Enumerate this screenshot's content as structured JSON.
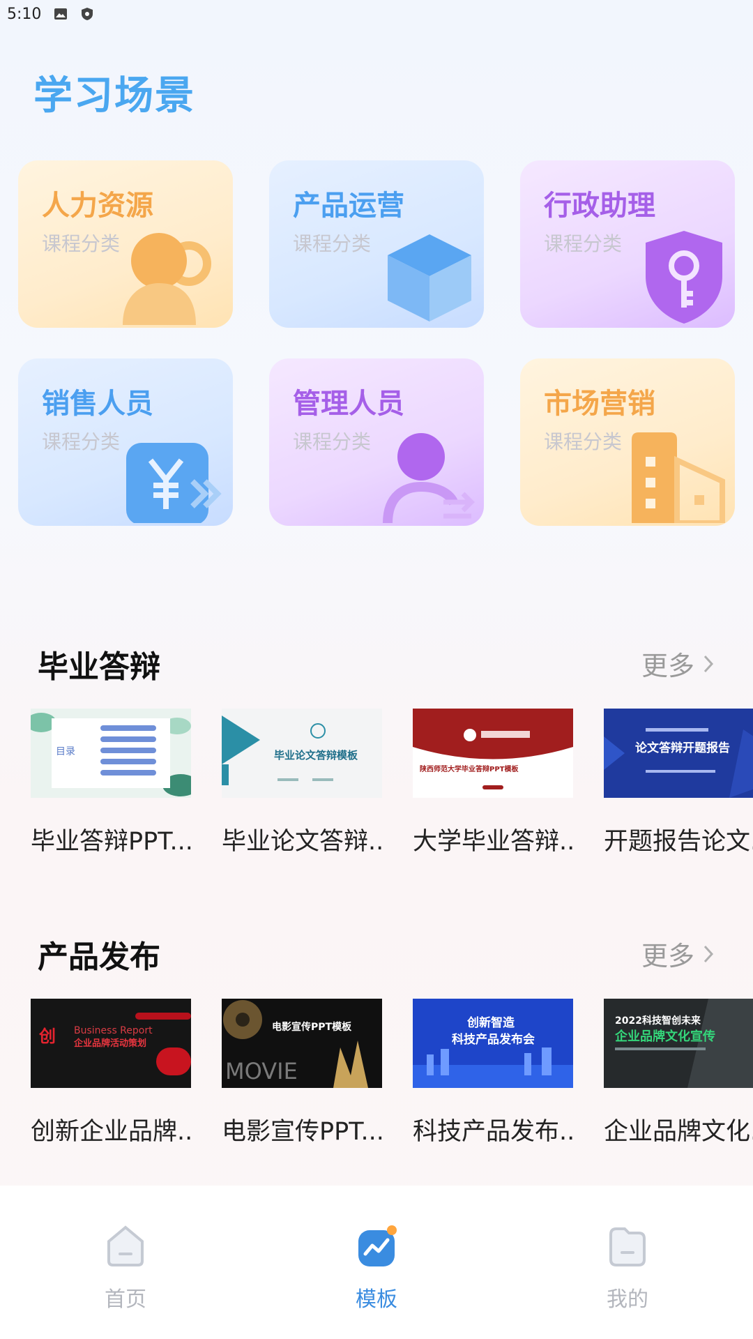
{
  "status": {
    "time": "5:10"
  },
  "learning": {
    "title": "学习场景",
    "cards": [
      {
        "title": "人力资源",
        "sub": "课程分类"
      },
      {
        "title": "产品运营",
        "sub": "课程分类"
      },
      {
        "title": "行政助理",
        "sub": "课程分类"
      },
      {
        "title": "销售人员",
        "sub": "课程分类"
      },
      {
        "title": "管理人员",
        "sub": "课程分类"
      },
      {
        "title": "市场营销",
        "sub": "课程分类"
      }
    ]
  },
  "graduation": {
    "title": "毕业答辩",
    "more": "更多",
    "items": [
      {
        "caption": "毕业答辩PPT...",
        "thumb_text": "目录"
      },
      {
        "caption": "毕业论文答辩...",
        "thumb_text": "毕业论文答辩模板"
      },
      {
        "caption": "大学毕业答辩...",
        "thumb_text": "陕西师范大学毕业答辩PPT模板"
      },
      {
        "caption": "开题报告论文...",
        "thumb_text": "论文答辩开题报告"
      }
    ]
  },
  "product_launch": {
    "title": "产品发布",
    "more": "更多",
    "items": [
      {
        "caption": "创新企业品牌...",
        "thumb_text": "企业品牌活动策划",
        "thumb_text2": "Business Report"
      },
      {
        "caption": "电影宣传PPT...",
        "thumb_text": "电影宣传PPT模板",
        "thumb_text2": "MOVIE"
      },
      {
        "caption": "科技产品发布...",
        "thumb_text": "创新智造",
        "thumb_text2": "科技产品发布会"
      },
      {
        "caption": "企业品牌文化...",
        "thumb_text": "2022科技智创未来",
        "thumb_text2": "企业品牌文化宣传"
      }
    ]
  },
  "tabbar": {
    "tabs": [
      {
        "label": "首页"
      },
      {
        "label": "模板"
      },
      {
        "label": "我的"
      }
    ]
  },
  "colors": {
    "accent": "#3a8ce0",
    "orange": "#f4a64a",
    "blue": "#4b9ff0",
    "purple": "#a55fe8"
  }
}
